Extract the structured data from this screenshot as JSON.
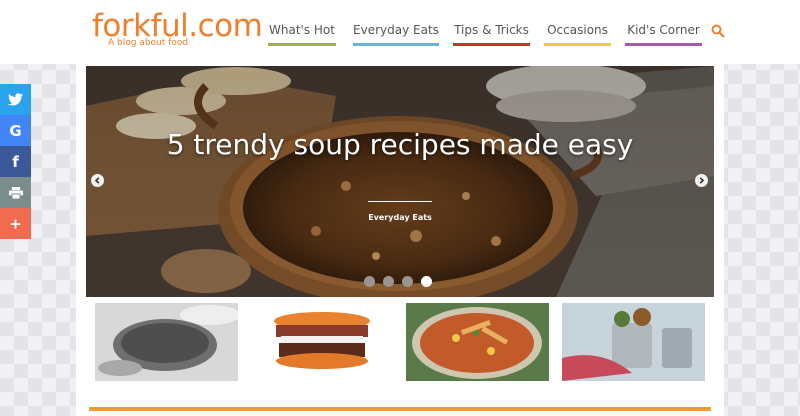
{
  "site": {
    "logo_text": "forkful.com",
    "tagline": "A blog about food",
    "brand_color": "#ef7f2a"
  },
  "nav": {
    "items": [
      {
        "label": "What's Hot",
        "color": "#9ab342"
      },
      {
        "label": "Everyday Eats",
        "color": "#6cb3d6"
      },
      {
        "label": "Tips & Tricks",
        "color": "#c0362c"
      },
      {
        "label": "Occasions",
        "color": "#f4c542"
      },
      {
        "label": "Kid's Corner",
        "color": "#a45ca8"
      }
    ],
    "search_icon": "search-icon"
  },
  "share": {
    "buttons": [
      {
        "name": "twitter-icon",
        "glyph": "t",
        "color": "#2aa3ef"
      },
      {
        "name": "google-icon",
        "glyph": "G",
        "color": "#4285f4"
      },
      {
        "name": "facebook-icon",
        "glyph": "f",
        "color": "#3b5998"
      },
      {
        "name": "print-icon",
        "glyph": "⎙",
        "color": "#7a8c8c"
      },
      {
        "name": "plus-icon",
        "glyph": "+",
        "color": "#f06b4f"
      }
    ]
  },
  "slider": {
    "title": "5 trendy soup recipes made easy",
    "category": "Everyday Eats",
    "slide_count": 4,
    "active_slide": 4
  }
}
